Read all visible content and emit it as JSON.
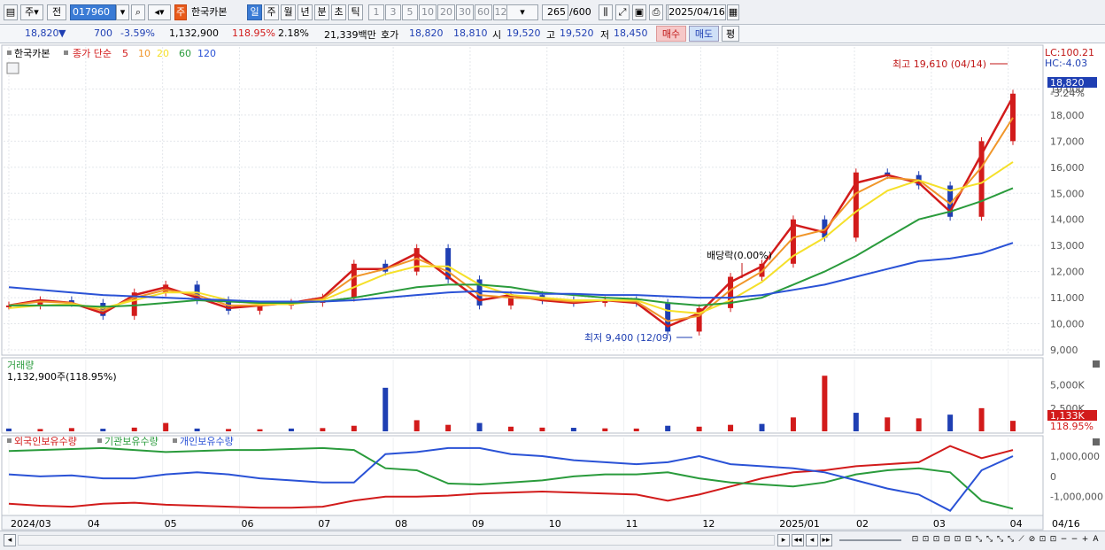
{
  "toolbar": {
    "market": "주",
    "prev": "전",
    "code": "017960",
    "badge": "주",
    "name": "한국카본",
    "periods": [
      "일",
      "주",
      "월",
      "년",
      "분",
      "초",
      "틱"
    ],
    "active_period": "일",
    "nums": [
      "1",
      "3",
      "5",
      "10",
      "20",
      "30",
      "60",
      "120"
    ],
    "count": "265",
    "total": "/600",
    "date": "2025/04/16"
  },
  "quote": {
    "price": "18,820",
    "arrow": "▼",
    "change": "700",
    "change_pct": "-3.59%",
    "volume": "1,132,900",
    "vol_ratio": "118.95%",
    "turnover": "2.18%",
    "amount": "21,339백만",
    "ask_label": "호가",
    "ask": "18,820",
    "bid": "18,810",
    "open_label": "시",
    "open": "19,520",
    "high_label": "고",
    "high": "19,520",
    "low_label": "저",
    "low": "18,450",
    "buy": "매수",
    "sell": "매도",
    "avg": "평"
  },
  "chart_data": [
    {
      "type": "line",
      "title": "",
      "legend": {
        "name": "한국카본",
        "mode": "종가 단순",
        "periods": [
          "5",
          "10",
          "20",
          "60",
          "120"
        ],
        "colors": [
          "#d21b1b",
          "#f0962a",
          "#f5e02a",
          "#2a9b3c",
          "#2a52d6"
        ]
      },
      "x_ticks": [
        "2024/03",
        "04",
        "05",
        "06",
        "07",
        "08",
        "09",
        "10",
        "11",
        "12",
        "2025/01",
        "02",
        "03",
        "04"
      ],
      "x_right_label": "04/16",
      "ylim": [
        9000,
        20000
      ],
      "y_ticks": [
        "9,000",
        "10,000",
        "11,000",
        "12,000",
        "13,000",
        "14,000",
        "15,000",
        "16,000",
        "17,000",
        "18,000",
        "19,000"
      ],
      "right_labels": {
        "lc": "LC:100.21",
        "hc": "HC:-4.03",
        "price": "18,820",
        "pct": "-3.24%"
      },
      "annotations": {
        "high": "최고 19,610 (04/14)",
        "low": "최저 9,400 (12/09)",
        "dividend": "배당락(0.00%)"
      },
      "close": [
        {
          "d": "2024-03",
          "v": 10700
        },
        {
          "d": "2024-03-mid",
          "v": 10900
        },
        {
          "d": "2024-04",
          "v": 10800
        },
        {
          "d": "2024-04-mid",
          "v": 10300
        },
        {
          "d": "2024-05",
          "v": 11200
        },
        {
          "d": "2024-05-mid",
          "v": 11500
        },
        {
          "d": "2024-06",
          "v": 10900
        },
        {
          "d": "2024-06-mid",
          "v": 10500
        },
        {
          "d": "2024-07",
          "v": 10700
        },
        {
          "d": "2024-07-mid",
          "v": 10800
        },
        {
          "d": "2024-07-end",
          "v": 11000
        },
        {
          "d": "2024-08",
          "v": 12300
        },
        {
          "d": "2024-08-mid",
          "v": 12000
        },
        {
          "d": "2024-08-end",
          "v": 12900
        },
        {
          "d": "2024-09",
          "v": 11700
        },
        {
          "d": "2024-09-mid",
          "v": 10700
        },
        {
          "d": "2024-10",
          "v": 11100
        },
        {
          "d": "2024-10-mid",
          "v": 10900
        },
        {
          "d": "2024-11",
          "v": 10800
        },
        {
          "d": "2024-11-mid",
          "v": 10900
        },
        {
          "d": "2024-12",
          "v": 10800
        },
        {
          "d": "2024-12-mid",
          "v": 9700
        },
        {
          "d": "2024-12-end",
          "v": 10600
        },
        {
          "d": "2025-01",
          "v": 11800
        },
        {
          "d": "2025-01-mid",
          "v": 12300
        },
        {
          "d": "2025-02",
          "v": 14000
        },
        {
          "d": "2025-02-mid",
          "v": 13300
        },
        {
          "d": "2025-03",
          "v": 15800
        },
        {
          "d": "2025-03-mid",
          "v": 15700
        },
        {
          "d": "2025-03-end",
          "v": 15300
        },
        {
          "d": "2025-04",
          "v": 14100
        },
        {
          "d": "2025-04-mid",
          "v": 17000
        },
        {
          "d": "2025-04-16",
          "v": 18820
        }
      ],
      "ma": [
        {
          "name": "5",
          "values": [
            10700,
            10900,
            10800,
            10400,
            11100,
            11400,
            11000,
            10600,
            10700,
            10800,
            11000,
            12100,
            12100,
            12700,
            11800,
            10900,
            11100,
            10900,
            10800,
            10900,
            10800,
            9900,
            10400,
            11600,
            12200,
            13800,
            13500,
            15400,
            15700,
            15400,
            14300,
            16500,
            18700
          ]
        },
        {
          "name": "10",
          "values": [
            10700,
            10850,
            10800,
            10500,
            11000,
            11300,
            11100,
            10700,
            10700,
            10800,
            10950,
            11800,
            12100,
            12500,
            12000,
            11100,
            11000,
            10950,
            10850,
            10900,
            10850,
            10100,
            10300,
            11300,
            12000,
            13300,
            13600,
            15000,
            15600,
            15500,
            14600,
            16000,
            17900
          ]
        },
        {
          "name": "20",
          "values": [
            10600,
            10700,
            10750,
            10600,
            10900,
            11200,
            11200,
            10900,
            10750,
            10750,
            10900,
            11400,
            11900,
            12200,
            12200,
            11500,
            11100,
            11000,
            10900,
            10900,
            10900,
            10500,
            10400,
            10900,
            11600,
            12600,
            13300,
            14300,
            15100,
            15500,
            15100,
            15400,
            16200
          ]
        },
        {
          "name": "60",
          "values": [
            10700,
            10700,
            10700,
            10650,
            10700,
            10800,
            10900,
            10850,
            10800,
            10800,
            10850,
            11000,
            11200,
            11400,
            11500,
            11500,
            11400,
            11200,
            11100,
            11000,
            10950,
            10800,
            10700,
            10800,
            11000,
            11500,
            12000,
            12600,
            13300,
            14000,
            14300,
            14700,
            15200
          ]
        },
        {
          "name": "120",
          "values": [
            11400,
            11300,
            11200,
            11100,
            11050,
            11000,
            10950,
            10900,
            10850,
            10850,
            10850,
            10900,
            11000,
            11100,
            11200,
            11250,
            11200,
            11150,
            11150,
            11100,
            11100,
            11050,
            11000,
            11000,
            11100,
            11300,
            11500,
            11800,
            12100,
            12400,
            12500,
            12700,
            13100
          ]
        }
      ]
    },
    {
      "type": "bar",
      "title": "거래량",
      "subtitle": "1,132,900주(118.95%)",
      "ylim": [
        0,
        6500000
      ],
      "y_ticks": [
        "2,500K",
        "5,000K"
      ],
      "last_label": "1,133K",
      "last_pct": "118.95%",
      "values": [
        300000,
        250000,
        350000,
        280000,
        400000,
        900000,
        300000,
        250000,
        220000,
        300000,
        350000,
        600000,
        4700000,
        1200000,
        700000,
        900000,
        500000,
        400000,
        380000,
        320000,
        300000,
        600000,
        500000,
        700000,
        800000,
        1500000,
        6000000,
        2000000,
        1500000,
        1400000,
        1800000,
        2500000,
        1133000
      ]
    },
    {
      "type": "line",
      "title": "",
      "legend": [
        "외국인보유수량",
        "기관보유수량",
        "개인보유수량"
      ],
      "colors": [
        "#d21b1b",
        "#2a9b3c",
        "#2a52d6"
      ],
      "ylim": [
        -1800000,
        1700000
      ],
      "y_ticks": [
        "1,000,000",
        "0",
        "-1,000,000"
      ],
      "series": [
        {
          "name": "외국인보유수량",
          "values": [
            -1350000,
            -1450000,
            -1500000,
            -1350000,
            -1300000,
            -1400000,
            -1450000,
            -1500000,
            -1550000,
            -1550000,
            -1500000,
            -1200000,
            -1000000,
            -1000000,
            -950000,
            -850000,
            -800000,
            -750000,
            -800000,
            -850000,
            -900000,
            -1200000,
            -900000,
            -500000,
            -100000,
            200000,
            300000,
            500000,
            600000,
            700000,
            1500000,
            900000,
            1300000
          ]
        },
        {
          "name": "기관보유수량",
          "values": [
            1250000,
            1300000,
            1350000,
            1400000,
            1300000,
            1200000,
            1250000,
            1300000,
            1300000,
            1350000,
            1400000,
            1300000,
            400000,
            300000,
            -350000,
            -400000,
            -300000,
            -200000,
            0,
            100000,
            100000,
            200000,
            -100000,
            -300000,
            -400000,
            -500000,
            -300000,
            100000,
            300000,
            400000,
            200000,
            -1200000,
            -1600000
          ]
        },
        {
          "name": "개인보유수량",
          "values": [
            100000,
            0,
            50000,
            -100000,
            -100000,
            100000,
            200000,
            100000,
            -100000,
            -200000,
            -300000,
            -300000,
            1100000,
            1200000,
            1400000,
            1400000,
            1100000,
            1000000,
            800000,
            700000,
            600000,
            700000,
            1000000,
            600000,
            500000,
            400000,
            200000,
            -200000,
            -600000,
            -900000,
            -1700000,
            300000,
            1000000
          ]
        }
      ]
    }
  ],
  "bottom": {
    "x_ticks": [
      "2024/03",
      "04",
      "05",
      "06",
      "07",
      "08",
      "09",
      "10",
      "11",
      "12",
      "2025/01",
      "02",
      "03",
      "04"
    ],
    "right": "04/16"
  }
}
